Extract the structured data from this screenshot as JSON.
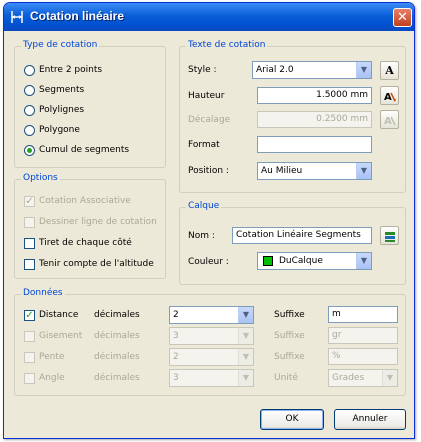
{
  "window": {
    "title": "Cotation linéaire",
    "close_glyph": "✕",
    "title_icon": "dimension-icon"
  },
  "type_cotation": {
    "legend": "Type de cotation",
    "options": [
      {
        "label": "Entre 2 points",
        "selected": false
      },
      {
        "label": "Segments",
        "selected": false
      },
      {
        "label": "Polylignes",
        "selected": false
      },
      {
        "label": "Polygone",
        "selected": false
      },
      {
        "label": "Cumul de segments",
        "selected": true
      }
    ]
  },
  "options": {
    "legend": "Options",
    "items": [
      {
        "label": "Cotation Associative",
        "checked": true,
        "enabled": false
      },
      {
        "label": "Dessiner ligne de cotation",
        "checked": false,
        "enabled": false
      },
      {
        "label": "Tiret de chaque côté",
        "checked": false,
        "enabled": true
      },
      {
        "label": "Tenir compte de l'altitude",
        "checked": false,
        "enabled": true
      }
    ]
  },
  "texte": {
    "legend": "Texte de cotation",
    "style_label": "Style :",
    "style_value": "Arial 2.0",
    "style_button": "A",
    "hauteur_label": "Hauteur",
    "hauteur_value": "1.5000 mm",
    "decalage_label": "Décalage",
    "decalage_value": "0.2500 mm",
    "format_label": "Format",
    "format_value": "",
    "position_label": "Position :",
    "position_value": "Au Milieu"
  },
  "calque": {
    "legend": "Calque",
    "nom_label": "Nom :",
    "nom_value": "Cotation Linéaire Segments",
    "couleur_label": "Couleur :",
    "couleur_value": "DuCalque",
    "couleur_swatch": "#00c000"
  },
  "donnees": {
    "legend": "Données",
    "dec_label": "décimales",
    "rows": [
      {
        "label": "Distance",
        "checked": true,
        "enabled": true,
        "decimals": "2",
        "suffix_label": "Suffixe",
        "suffix_value": "m",
        "suffix_is_select": false
      },
      {
        "label": "Gisement",
        "checked": false,
        "enabled": false,
        "decimals": "3",
        "suffix_label": "Suffixe",
        "suffix_value": "gr",
        "suffix_is_select": false
      },
      {
        "label": "Pente",
        "checked": false,
        "enabled": false,
        "decimals": "2",
        "suffix_label": "Suffixe",
        "suffix_value": "%",
        "suffix_is_select": false
      },
      {
        "label": "Angle",
        "checked": false,
        "enabled": false,
        "decimals": "3",
        "suffix_label": "Unité",
        "suffix_value": "Grades",
        "suffix_is_select": true
      }
    ]
  },
  "buttons": {
    "ok": "OK",
    "cancel": "Annuler"
  }
}
